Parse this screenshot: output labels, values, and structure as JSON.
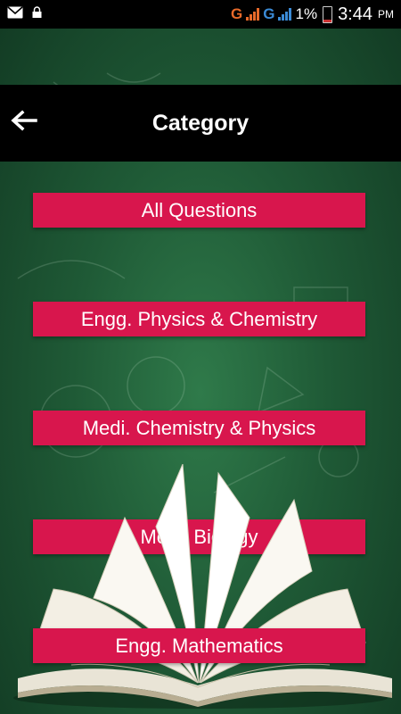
{
  "status_bar": {
    "network_1": "G",
    "network_2": "G",
    "battery_percent": "1%",
    "time": "3:44",
    "ampm": "PM"
  },
  "app_bar": {
    "title": "Category",
    "back_icon": "arrow-back-icon"
  },
  "categories": [
    {
      "label": "All Questions"
    },
    {
      "label": "Engg. Physics & Chemistry"
    },
    {
      "label": "Medi. Chemistry & Physics"
    },
    {
      "label": "Medi. Biology"
    },
    {
      "label": "Engg. Mathematics"
    }
  ],
  "colors": {
    "button_bg": "#d8164d",
    "app_bar_bg": "#000000",
    "background": "#1f5a36"
  }
}
